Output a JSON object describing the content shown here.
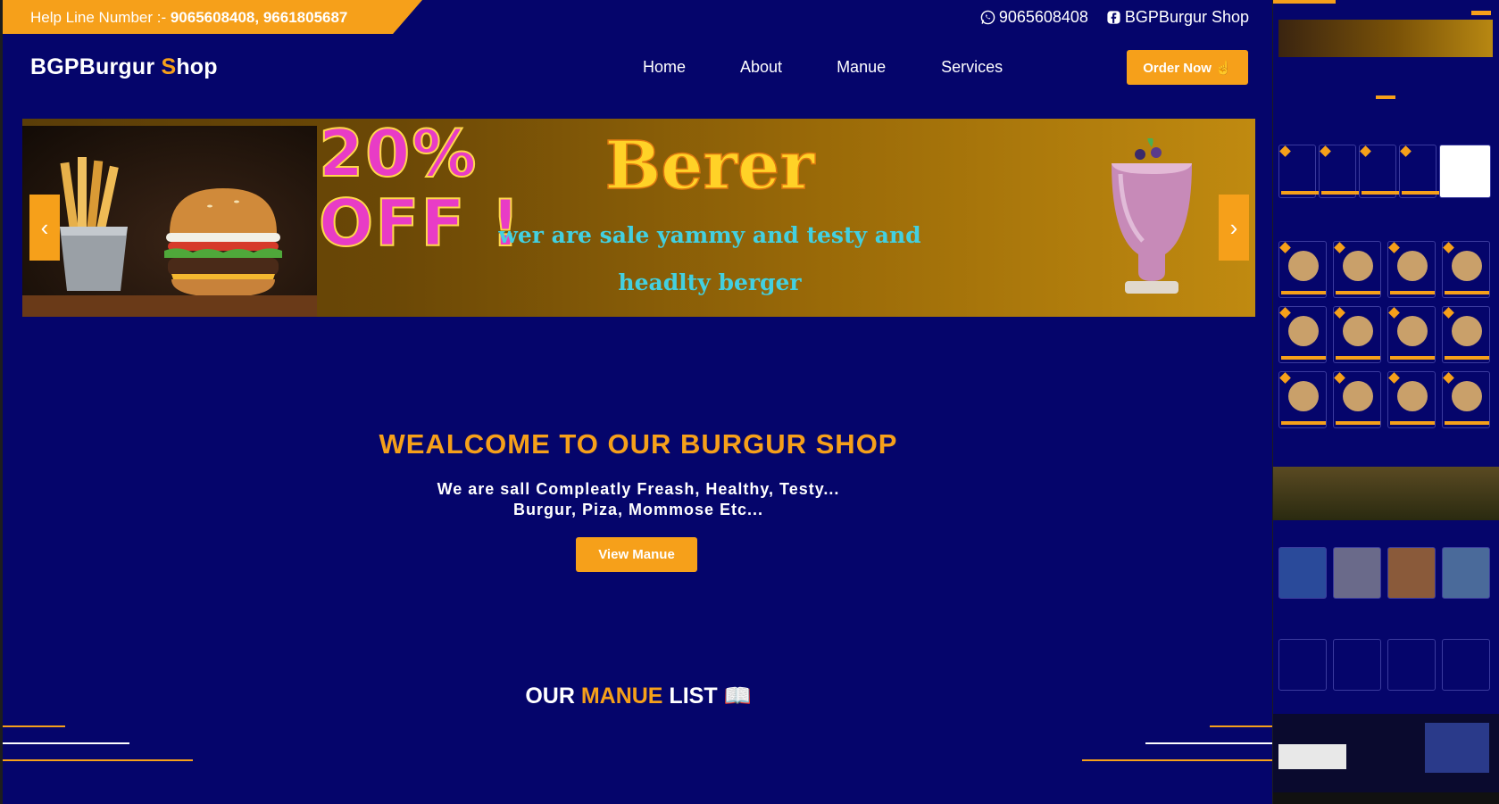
{
  "topbar": {
    "helpline_label": "Help Line Number :- ",
    "helpline_numbers": "9065608408, 9661805687",
    "whatsapp": "9065608408",
    "facebook": "BGPBurgur Shop"
  },
  "header": {
    "brand_prefix": "BGPBurgur ",
    "brand_accent": "S",
    "brand_suffix": "hop",
    "nav": [
      "Home",
      "About",
      "Manue",
      "Services"
    ],
    "order_button": "Order Now ☝"
  },
  "banner": {
    "discount_line1": "20%",
    "discount_line2": "OFF !",
    "headline": "Berer",
    "tagline": "wer are sale yammy and testy and headlty berger",
    "prev": "‹",
    "next": "›"
  },
  "welcome": {
    "title": "WEALCOME TO OUR BURGUR SHOP",
    "line1": "We are sall Compleatly Freash, Healthy, Testy...",
    "line2": "Burgur, Piza, Mommose Etc...",
    "button": "View Manue"
  },
  "menu_section": {
    "prefix": "OUR ",
    "accent": "MANUE",
    "suffix": " LIST 📖"
  },
  "colors": {
    "background": "#05056b",
    "accent": "#f6a01a"
  },
  "icons": [
    "whatsapp-icon",
    "facebook-icon",
    "hand-pointer-icon",
    "book-icon",
    "chevron-left-icon",
    "chevron-right-icon"
  ]
}
